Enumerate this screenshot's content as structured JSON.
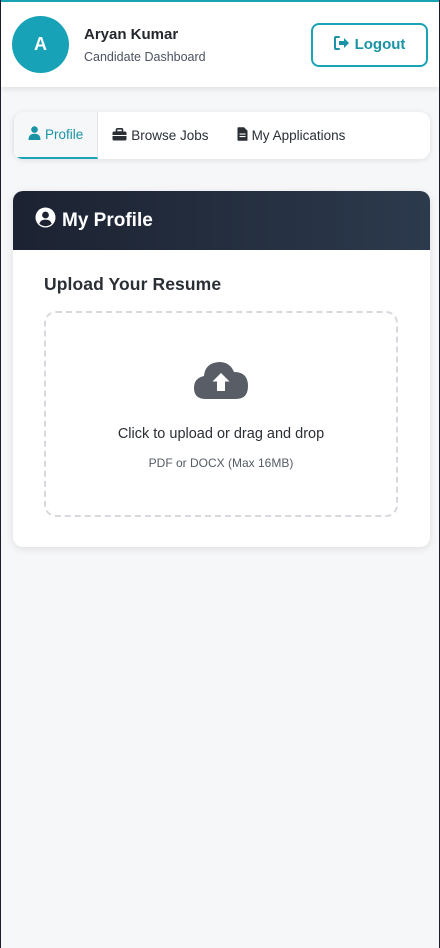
{
  "header": {
    "avatar_initial": "A",
    "user_name": "Aryan Kumar",
    "user_role": "Candidate Dashboard",
    "logout_label": "Logout",
    "logout_icon": "sign-out-icon"
  },
  "tabs": [
    {
      "label": "Profile",
      "icon": "user-icon",
      "active": true
    },
    {
      "label": "Browse Jobs",
      "icon": "briefcase-icon",
      "active": false
    },
    {
      "label": "My Applications",
      "icon": "file-icon",
      "active": false
    }
  ],
  "profile": {
    "title": "My Profile",
    "title_icon": "user-circle-icon",
    "upload_heading": "Upload Your Resume",
    "dropzone_text": "Click to upload or drag and drop",
    "dropzone_hint": "PDF or DOCX (Max 16MB)",
    "dropzone_icon": "cloud-upload-icon"
  },
  "colors": {
    "accent": "#1aa3b5",
    "header_dark": "#1c2231",
    "background": "#f6f7f9"
  }
}
